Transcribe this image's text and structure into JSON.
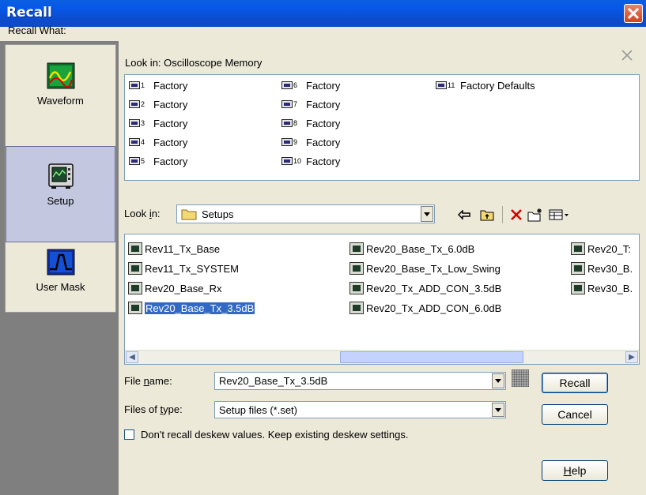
{
  "window": {
    "title": "Recall"
  },
  "sidebar": {
    "label": "Recall What:",
    "items": [
      {
        "label": "Waveform",
        "icon": "waveform-icon",
        "selected": false
      },
      {
        "label": "Setup",
        "icon": "setup-icon",
        "selected": true
      },
      {
        "label": "User Mask",
        "icon": "user-mask-icon",
        "selected": false
      }
    ]
  },
  "memory": {
    "lookin_label": "Look in: Oscilloscope Memory",
    "items": [
      {
        "num": "1",
        "label": "Factory"
      },
      {
        "num": "2",
        "label": "Factory"
      },
      {
        "num": "3",
        "label": "Factory"
      },
      {
        "num": "4",
        "label": "Factory"
      },
      {
        "num": "5",
        "label": "Factory"
      },
      {
        "num": "6",
        "label": "Factory"
      },
      {
        "num": "7",
        "label": "Factory"
      },
      {
        "num": "8",
        "label": "Factory"
      },
      {
        "num": "9",
        "label": "Factory"
      },
      {
        "num": "10",
        "label": "Factory"
      },
      {
        "num": "11",
        "label": "Factory Defaults"
      }
    ]
  },
  "browser": {
    "lookin_prefix": "Look ",
    "lookin_underlined": "i",
    "lookin_suffix": "n:",
    "folder": "Setups",
    "toolbar": [
      "back-icon",
      "up-folder-icon",
      "delete-icon",
      "new-folder-icon",
      "view-menu-icon"
    ],
    "files": [
      {
        "name": "Rev11_Tx_Base",
        "selected": false
      },
      {
        "name": "Rev11_Tx_SYSTEM",
        "selected": false
      },
      {
        "name": "Rev20_Base_Rx",
        "selected": false
      },
      {
        "name": "Rev20_Base_Tx_3.5dB",
        "selected": true
      },
      {
        "name": "Rev20_Base_Tx_6.0dB",
        "selected": false
      },
      {
        "name": "Rev20_Base_Tx_Low_Swing",
        "selected": false
      },
      {
        "name": "Rev20_Tx_ADD_CON_3.5dB",
        "selected": false
      },
      {
        "name": "Rev20_Tx_ADD_CON_6.0dB",
        "selected": false
      },
      {
        "name": "Rev20_T:",
        "selected": false
      },
      {
        "name": "Rev30_B.",
        "selected": false
      },
      {
        "name": "Rev30_B.",
        "selected": false
      }
    ]
  },
  "form": {
    "filename_label_pre": "File ",
    "filename_label_u": "n",
    "filename_label_post": "ame:",
    "filename_value": "Rev20_Base_Tx_3.5dB",
    "filetype_label_pre": "Files of ",
    "filetype_label_u": "t",
    "filetype_label_post": "ype:",
    "filetype_value": "Setup files (*.set)",
    "deskew_label": "Don't recall deskew values. Keep existing deskew settings.",
    "deskew_checked": false
  },
  "buttons": {
    "recall": "Recall",
    "cancel": "Cancel",
    "help_u": "H",
    "help_rest": "elp"
  },
  "colors": {
    "title_blue": "#0758e8",
    "selection": "#316ac5",
    "nav_selected": "#c3c7df"
  }
}
